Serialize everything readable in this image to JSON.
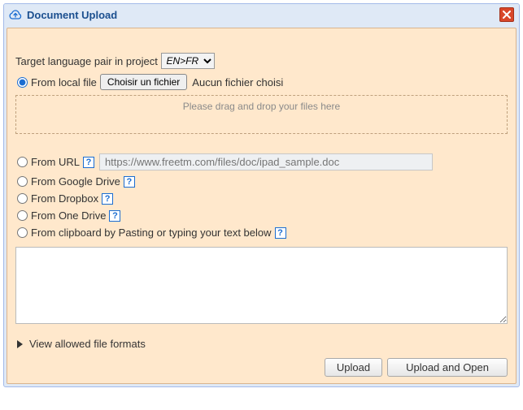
{
  "dialog": {
    "title": "Document Upload"
  },
  "targetLang": {
    "label": "Target language pair in project",
    "selected": "EN>FR"
  },
  "sources": {
    "localFile": {
      "label": "From local file",
      "chooseButton": "Choisir un fichier",
      "status": "Aucun fichier choisi",
      "dropzoneHint": "Please drag and drop your files here"
    },
    "url": {
      "label": "From URL",
      "placeholder": "https://www.freetm.com/files/doc/ipad_sample.doc"
    },
    "googleDrive": {
      "label": "From Google Drive"
    },
    "dropbox": {
      "label": "From Dropbox"
    },
    "oneDrive": {
      "label": "From One Drive"
    },
    "clipboard": {
      "label": "From clipboard by Pasting or typing your text below"
    }
  },
  "allowedFormats": {
    "label": "View allowed file formats"
  },
  "buttons": {
    "upload": "Upload",
    "uploadAndOpen": "Upload and Open"
  },
  "helpGlyph": "?"
}
